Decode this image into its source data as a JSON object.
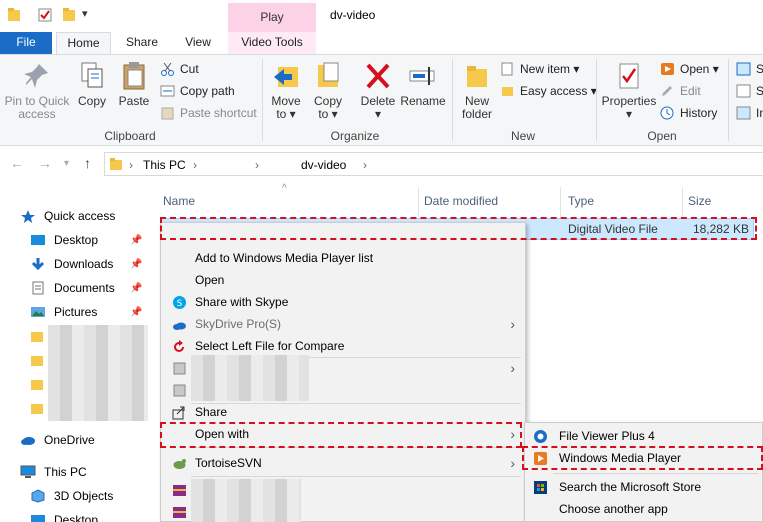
{
  "window": {
    "title": "dv-video",
    "context_tab_group": "Play"
  },
  "tabs": [
    {
      "label": "File"
    },
    {
      "label": "Home"
    },
    {
      "label": "Share"
    },
    {
      "label": "View"
    },
    {
      "label": "Video Tools"
    }
  ],
  "ribbon": {
    "clipboard": {
      "pin_line1": "Pin to Quick",
      "pin_line2": "access",
      "copy": "Copy",
      "paste": "Paste",
      "cut": "Cut",
      "copy_path": "Copy path",
      "paste_shortcut": "Paste shortcut",
      "group": "Clipboard"
    },
    "organize": {
      "move_to": "Move",
      "move_to_sub": "to ▾",
      "copy_to": "Copy",
      "copy_to_sub": "to ▾",
      "delete": "Delete",
      "delete_sub": "▾",
      "rename": "Rename",
      "group": "Organize"
    },
    "new": {
      "new_folder_line1": "New",
      "new_folder_line2": "folder",
      "new_item": "New item ▾",
      "easy_access": "Easy access ▾",
      "group": "New"
    },
    "open": {
      "properties": "Properties",
      "properties_sub": "▾",
      "open": "Open ▾",
      "edit": "Edit",
      "history": "History",
      "group": "Open"
    },
    "select": {
      "s1": "S",
      "s2": "S",
      "s3": "In"
    }
  },
  "address": {
    "crumbs": [
      "This PC",
      "dv-video"
    ],
    "sep": "›"
  },
  "nav": {
    "quick_access": "Quick access",
    "items": [
      "Desktop",
      "Downloads",
      "Documents",
      "Pictures"
    ],
    "onedrive": "OneDrive",
    "this_pc": "This PC",
    "pc_items": [
      "3D Objects",
      "Desktop"
    ]
  },
  "columns": {
    "name": "Name",
    "date_modified": "Date modified",
    "type": "Type",
    "size": "Size"
  },
  "file": {
    "type": "Digital Video File",
    "size": "18,282 KB"
  },
  "context_menu": {
    "add_to_wmp": "Add to Windows Media Player list",
    "open": "Open",
    "share_skype": "Share with Skype",
    "skydrive": "SkyDrive Pro(S)",
    "compare": "Select Left File for Compare",
    "share": "Share",
    "open_with": "Open with",
    "tortoise": "TortoiseSVN"
  },
  "submenu": {
    "file_viewer": "File Viewer Plus 4",
    "wmp": "Windows Media Player",
    "store": "Search the Microsoft Store",
    "another": "Choose another app"
  },
  "colors": {
    "file_tab": "#1a6cc6",
    "context_tab": "#fcd2e7",
    "selection": "#cce8ff",
    "highlight": "#d4101e"
  }
}
